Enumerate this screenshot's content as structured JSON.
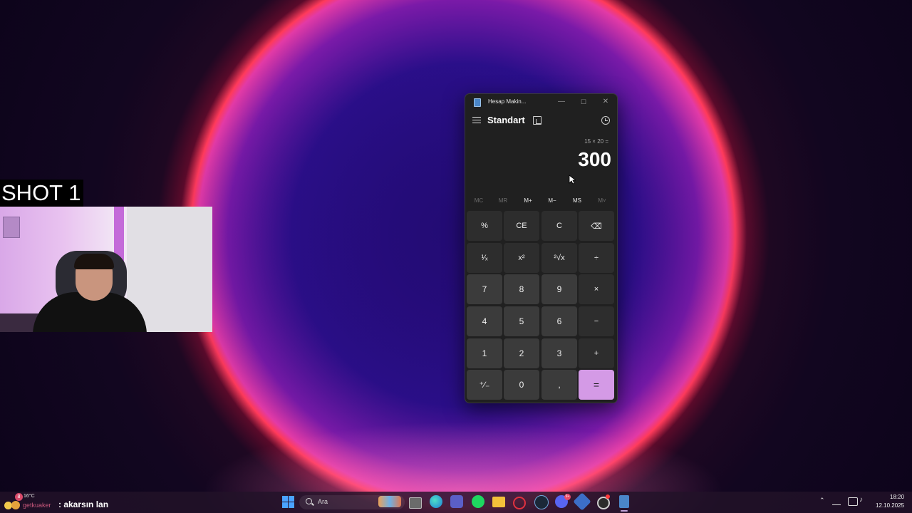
{
  "overlay": {
    "shot_label": "SHOT 1"
  },
  "calculator": {
    "window_title": "Hesap Makin...",
    "mode": "Standart",
    "expression": "15 × 20 =",
    "result": "300",
    "memory_buttons": [
      {
        "label": "MC",
        "enabled": false
      },
      {
        "label": "MR",
        "enabled": false
      },
      {
        "label": "M+",
        "enabled": true
      },
      {
        "label": "M−",
        "enabled": true
      },
      {
        "label": "MS",
        "enabled": true
      },
      {
        "label": "M˅",
        "enabled": false
      }
    ],
    "keys": [
      [
        "%",
        "CE",
        "C",
        "⌫"
      ],
      [
        "¹⁄ₓ",
        "x²",
        "²√x",
        "÷"
      ],
      [
        "7",
        "8",
        "9",
        "×"
      ],
      [
        "4",
        "5",
        "6",
        "−"
      ],
      [
        "1",
        "2",
        "3",
        "+"
      ],
      [
        "⁺∕₋",
        "0",
        ",",
        "="
      ]
    ],
    "accent_color": "#d49ae6"
  },
  "taskbar": {
    "weather": {
      "badge": "8",
      "temp": "16°C"
    },
    "chat": {
      "user": "getkuaker",
      "message": ": akarsın lan"
    },
    "search_placeholder": "Ara",
    "apps": [
      "file-explorer-window",
      "edge",
      "teams",
      "spotify",
      "file-explorer",
      "opera-gx",
      "steam",
      "discord",
      "app-9",
      "obs",
      "calculator"
    ],
    "discord_badge": "9+",
    "clock": {
      "time": "18:20",
      "date": "12.10.2025"
    }
  }
}
